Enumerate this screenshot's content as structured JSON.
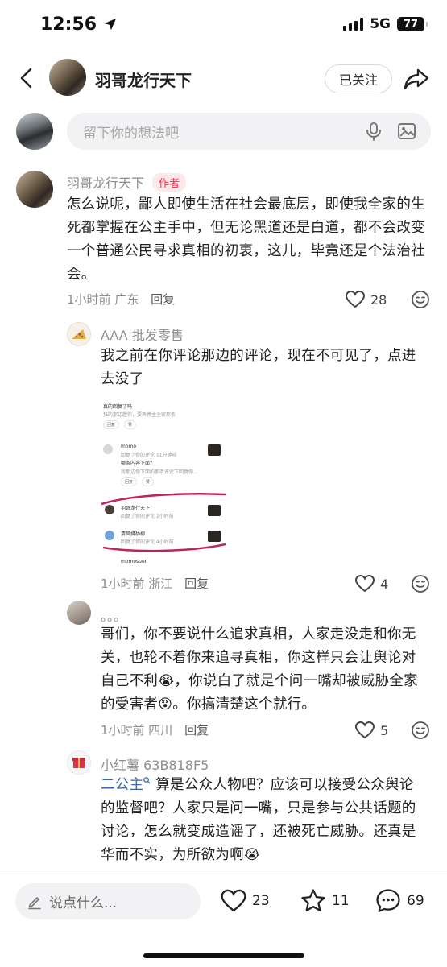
{
  "status_bar": {
    "time": "12:56",
    "network": "5G",
    "battery": "77"
  },
  "header": {
    "title": "羽哥龙行天下",
    "follow_label": "已关注"
  },
  "comment_input": {
    "placeholder": "留下你的想法吧"
  },
  "comments": [
    {
      "username": "羽哥龙行天下",
      "tag": "作者",
      "lines": [
        "怎么说呢，鄙人即使生活在社会最底层，即使我全家的生",
        "死都掌握在公主手中，但无论黑道还是白道，都不会改变",
        "一个普通公民寻求真相的初衷，这儿，毕竟还是个法治社",
        "会。"
      ],
      "time_location": "1小时前 广东",
      "reply_label": "回复",
      "likes": "28"
    },
    {
      "username": "AAA 批发零售",
      "lines": [
        "我之前在你评论那边的评论，现在不可见了，点进",
        "去没了"
      ],
      "time_location": "1小时前 浙江",
      "reply_label": "回复",
      "likes": "4",
      "screenshot": {
        "lines": [
          "真的回复了吗",
          "狂的那边趣你，要弄博主全家那条",
          "回复",
          "赞",
          "momo",
          "回复了你的评论 11分钟前",
          "哪条内容下面?",
          "我那边你下面的那条评论下回复你...",
          "回复",
          "赞",
          "羽哥龙行天下",
          "回复了你的评论 2小时前",
          "清风拂杨柳",
          "回复了你的评论 4小时前",
          "momosuen"
        ]
      }
    },
    {
      "username": "。。。",
      "lines": [
        "哥们，你不要说什么追求真相，人家走没走和你无",
        "关，也轮不着你来追寻真相，你这样只会让舆论对",
        "自己不利",
        "，你说白了就是个问一嘴却被威胁全家",
        "的受害者",
        "。你搞清楚这个就行。"
      ],
      "time_location": "1小时前 四川",
      "reply_label": "回复",
      "likes": "5"
    },
    {
      "username": "小红薯 63B818F5",
      "mention": "二公主",
      "lines": [
        "算是公众人物吧？应该可以接受公众舆论",
        "的监督吧？人家只是问一嘴，只是参与公共话题的",
        "讨论，怎么就变成造谣了，还被死亡威胁。还真是",
        "华而不实，为所欲为啊"
      ]
    }
  ],
  "bottom_bar": {
    "input_placeholder": "说点什么...",
    "likes": "23",
    "collects": "11",
    "comments": "69"
  },
  "colors": {
    "accent_red": "#ff2442",
    "mention_blue": "#3a6aa8",
    "underline_pink": "#c0245a"
  },
  "icons": [
    "navigation-arrow-icon",
    "signal-icon",
    "battery-icon",
    "back-chevron-icon",
    "share-icon",
    "microphone-icon",
    "image-icon",
    "heart-icon",
    "emoji-icon",
    "pen-icon",
    "star-icon",
    "comment-icon",
    "search-icon",
    "gift-icon"
  ]
}
